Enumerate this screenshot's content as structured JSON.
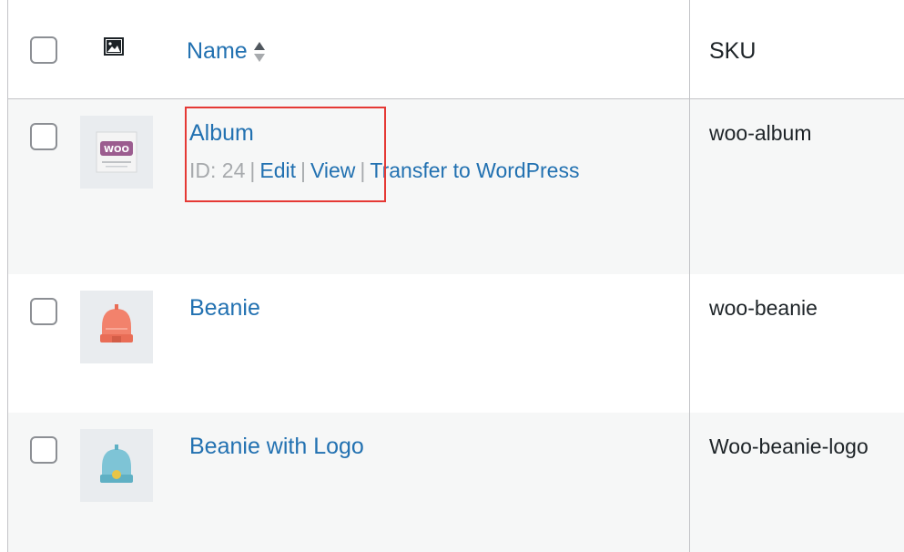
{
  "header": {
    "name_label": "Name",
    "sku_label": "SKU",
    "image_icon": "image-icon",
    "sort_icon": "sort-arrows-icon"
  },
  "rows": [
    {
      "name": "Album",
      "id_text": "ID: 24",
      "actions": [
        "Edit",
        "View",
        "Transfer to WordPress"
      ],
      "sku": "woo-album",
      "thumb": "album-thumbnail"
    },
    {
      "name": "Beanie",
      "sku": "woo-beanie",
      "thumb": "beanie-thumbnail"
    },
    {
      "name": "Beanie with Logo",
      "sku": "Woo-beanie-logo",
      "thumb": "beanie-with-logo-thumbnail"
    }
  ],
  "colors": {
    "link": "#2271b1",
    "row_alt": "#f6f7f7",
    "border": "#c3c4c7",
    "highlight": "#e53935"
  }
}
